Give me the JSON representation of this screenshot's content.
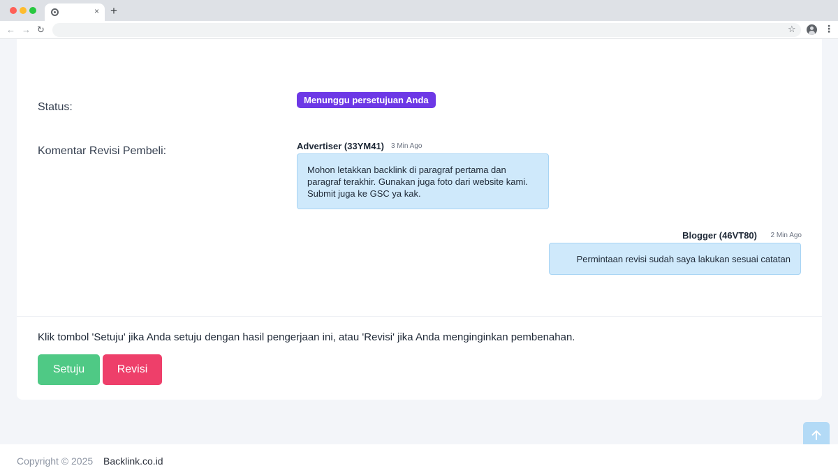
{
  "browser": {
    "new_tab_label": "+",
    "tab_close": "×",
    "back": "←",
    "forward": "→",
    "reload": "↻",
    "bookmark_star": "☆",
    "menu": "⋮"
  },
  "status": {
    "label": "Status:",
    "badge": "Menunggu persetujuan Anda",
    "badge_color": "#6d38e6"
  },
  "comments": {
    "label": "Komentar Revisi Pembeli:",
    "messages": [
      {
        "author": "Advertiser (33YM41)",
        "time": "3 Min Ago",
        "text": "Mohon letakkan backlink di paragraf pertama dan paragraf terakhir. Gunakan juga foto dari website kami. Submit juga ke GSC ya kak."
      },
      {
        "author": "Blogger (46VT80)",
        "time": "2 Min Ago",
        "text": "Permintaan revisi sudah saya lakukan sesuai catatan"
      }
    ]
  },
  "actions": {
    "instruction": "Klik tombol 'Setuju' jika Anda setuju dengan hasil pengerjaan ini, atau 'Revisi' jika Anda menginginkan pembenahan.",
    "approve_label": "Setuju",
    "revise_label": "Revisi",
    "approve_color": "#4fc985",
    "revise_color": "#ee3f6a"
  },
  "footer": {
    "copyright": "Copyright © 2025",
    "brand": "Backlink.co.id"
  }
}
